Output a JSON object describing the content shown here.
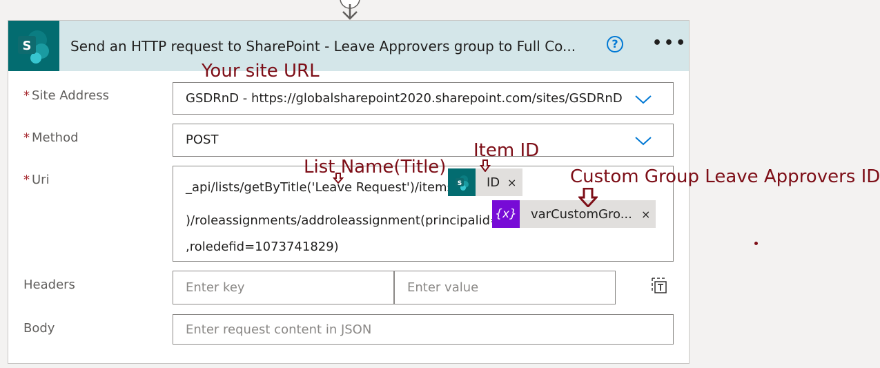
{
  "header": {
    "title": "Send an HTTP request to SharePoint - Leave Approvers group to Full Co...",
    "help_label": "?",
    "more_label": "•••"
  },
  "fields": {
    "site_address": {
      "label": "Site Address",
      "value": "GSDRnD - https://globalsharepoint2020.sharepoint.com/sites/GSDRnD"
    },
    "method": {
      "label": "Method",
      "value": "POST"
    },
    "uri": {
      "label": "Uri",
      "line1": "_api/lists/getByTitle('Leave Request')/items(",
      "line2": ")/roleassignments/addroleassignment(principalid=",
      "line3": ",roledefid=1073741829)",
      "token_id": "ID",
      "token_var": "varCustomGro...",
      "token_var_icon": "{x}",
      "token_close": "×"
    },
    "headers": {
      "label": "Headers",
      "key_placeholder": "Enter key",
      "value_placeholder": "Enter value"
    },
    "body": {
      "label": "Body",
      "placeholder": "Enter request content in JSON"
    }
  },
  "required_marker": "*",
  "annotations": {
    "site_url": "Your site URL",
    "item_id": "Item ID",
    "list_name": "List Name(Title)",
    "custom_group": "Custom Group Leave Approvers ID"
  },
  "icons": [
    "sharepoint-icon",
    "help-icon",
    "more-icon",
    "chevron-down-icon",
    "text-mode-icon",
    "variable-icon",
    "close-icon"
  ],
  "colors": {
    "header_bg": "#d4e6e9",
    "sharepoint_teal": "#036c70",
    "accent": "#0078d4",
    "variable_purple": "#770bd6",
    "annotation": "#7d0e17",
    "required": "#a4262c"
  }
}
